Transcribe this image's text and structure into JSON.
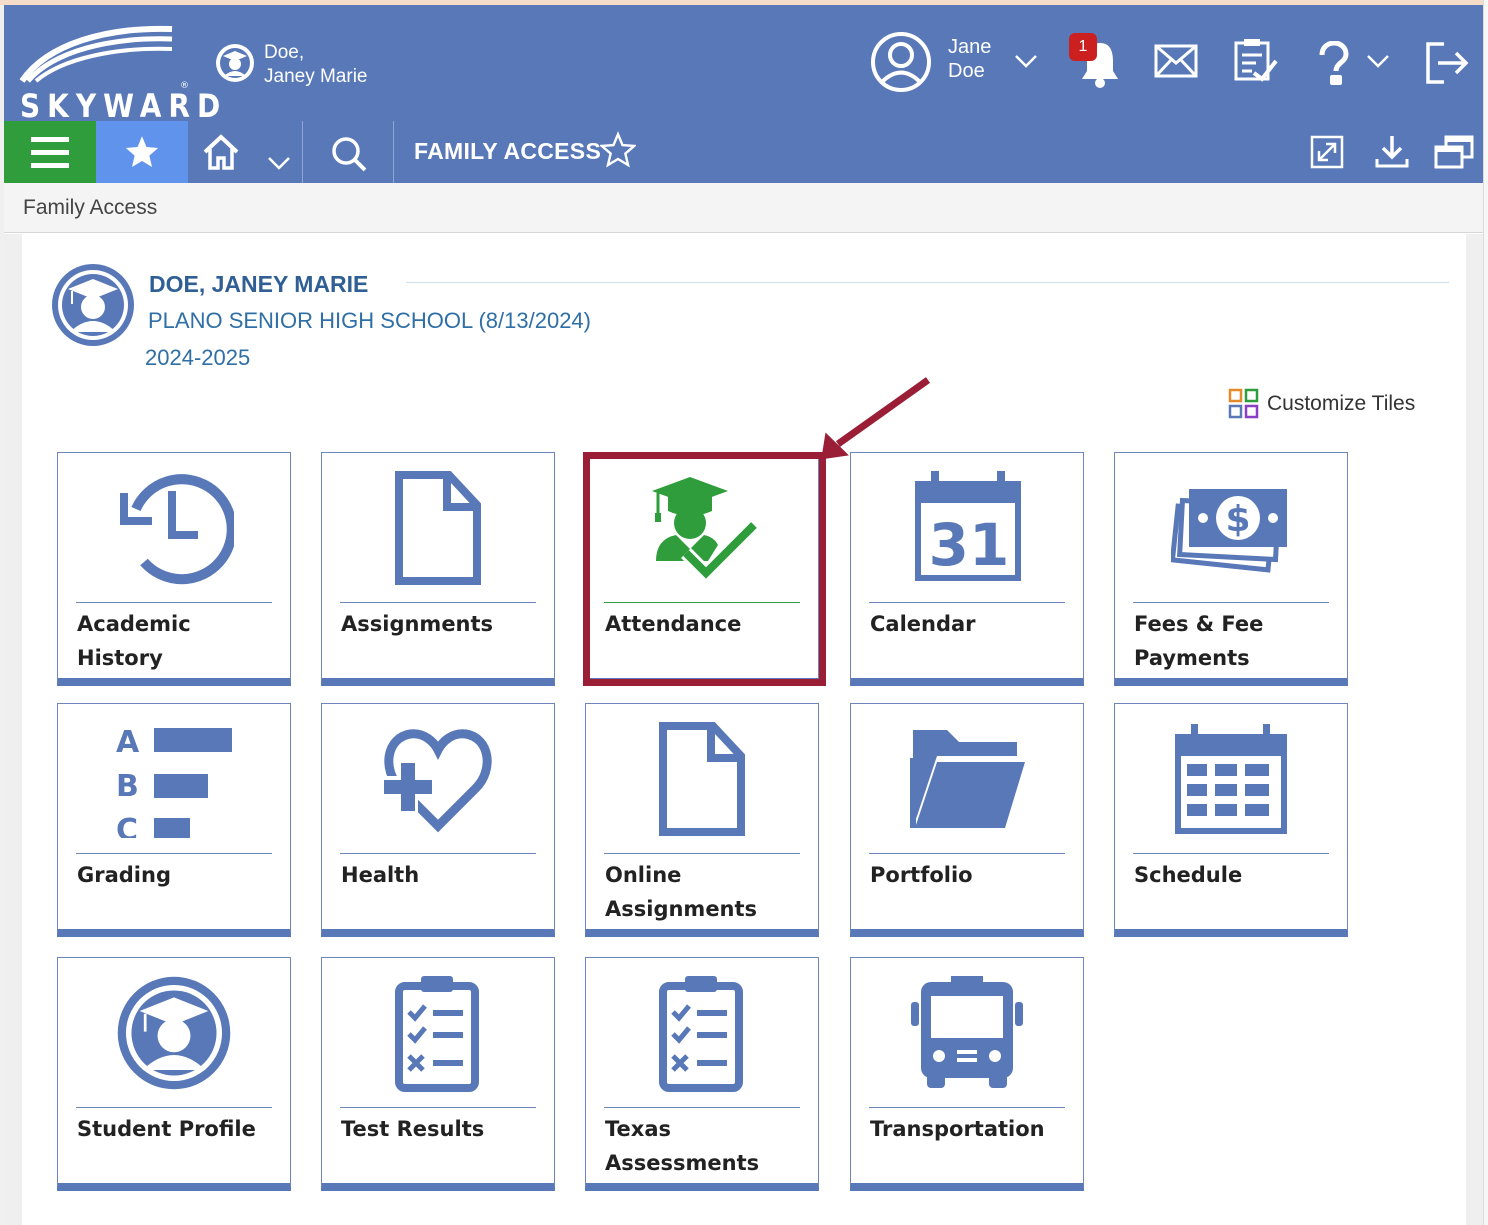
{
  "header": {
    "logo_text": "SKYWARD",
    "student_last": "Doe,",
    "student_first": "Janey Marie",
    "user_first": "Jane",
    "user_last": "Doe",
    "notification_count": "1"
  },
  "nav": {
    "title": "FAMILY ACCESS"
  },
  "breadcrumb": "Family Access",
  "student": {
    "name": "DOE, JANEY MARIE",
    "school": "PLANO SENIOR HIGH SCHOOL (8/13/2024)",
    "year": "2024-2025"
  },
  "customize_label": "Customize Tiles",
  "tiles": [
    {
      "label": "Academic History",
      "icon": "history-icon"
    },
    {
      "label": "Assignments",
      "icon": "document-icon"
    },
    {
      "label": "Attendance",
      "icon": "attendance-icon"
    },
    {
      "label": "Calendar",
      "icon": "calendar-icon"
    },
    {
      "label": "Fees & Fee Payments",
      "icon": "money-icon"
    },
    {
      "label": "Grading",
      "icon": "grading-icon"
    },
    {
      "label": "Health",
      "icon": "health-icon"
    },
    {
      "label": "Online Assignments",
      "icon": "document-icon"
    },
    {
      "label": "Portfolio",
      "icon": "folder-icon"
    },
    {
      "label": "Schedule",
      "icon": "schedule-icon"
    },
    {
      "label": "Student Profile",
      "icon": "student-icon"
    },
    {
      "label": "Test Results",
      "icon": "clipboard-icon"
    },
    {
      "label": "Texas Assessments",
      "icon": "clipboard-icon"
    },
    {
      "label": "Transportation",
      "icon": "bus-icon"
    }
  ],
  "calendar_day": "31",
  "colors": {
    "brand_blue": "#5878b8",
    "menu_green": "#2f9d3b",
    "favorite_blue": "#5f93ec",
    "highlight_red": "#9a1f36",
    "attendance_green": "#2f9d3b"
  }
}
